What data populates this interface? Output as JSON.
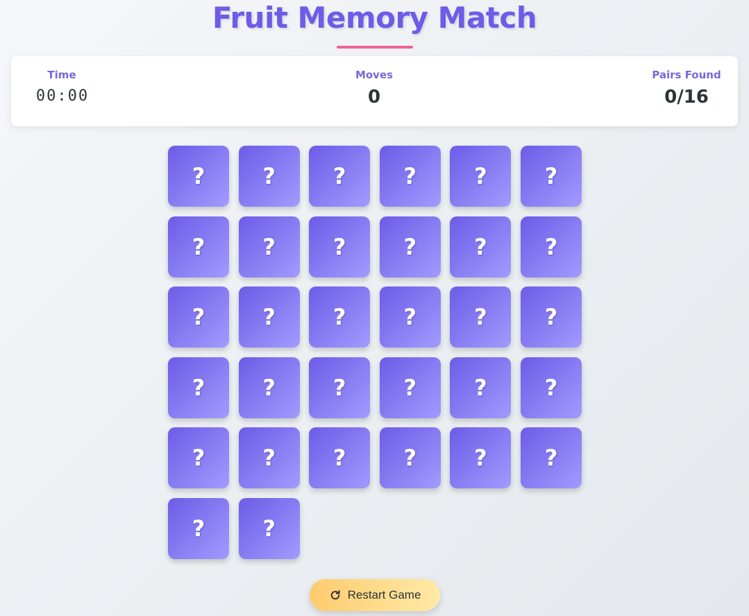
{
  "header": {
    "title": "Fruit Memory Match"
  },
  "stats": {
    "time_label": "Time",
    "time_value": "00:00",
    "moves_label": "Moves",
    "moves_value": "0",
    "pairs_label": "Pairs Found",
    "pairs_value": "0/16"
  },
  "board": {
    "card_back_symbol": "?",
    "cards_shown": 32,
    "columns": 6
  },
  "controls": {
    "restart_label": "Restart Game",
    "restart_icon": "redo-icon"
  },
  "colors": {
    "accent": "#6c5ce7",
    "card_gradient_end": "#a29bfe",
    "underline": "#f06292",
    "button_start": "#fdcb6e",
    "button_end": "#ffeaa7"
  }
}
